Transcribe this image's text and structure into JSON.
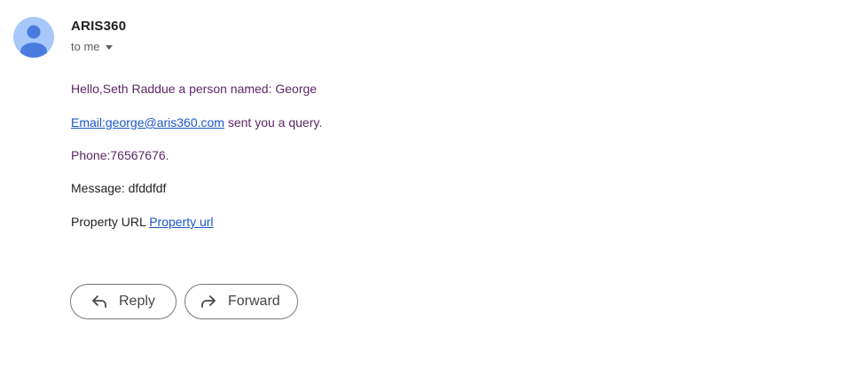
{
  "sender": {
    "name": "ARIS360",
    "recipient_label": "to me"
  },
  "message": {
    "greeting": "Hello,Seth Raddue a person named: George",
    "email_link": "Email:george@aris360.com",
    "email_suffix": " sent you a query.",
    "phone": "Phone:76567676.",
    "message_text": "Message: dfddfdf",
    "property_label": "Property URL ",
    "property_link": "Property url"
  },
  "actions": {
    "reply_label": "Reply",
    "forward_label": "Forward"
  },
  "icons": {
    "avatar": "person-avatar-icon",
    "details": "chevron-down-icon",
    "reply": "reply-arrow-icon",
    "forward": "forward-arrow-icon"
  },
  "colors": {
    "avatar_bg": "#a8c7fa",
    "avatar_fg": "#4a7ce0",
    "body_purple": "#5b2866",
    "link_blue": "#1a56c8"
  }
}
